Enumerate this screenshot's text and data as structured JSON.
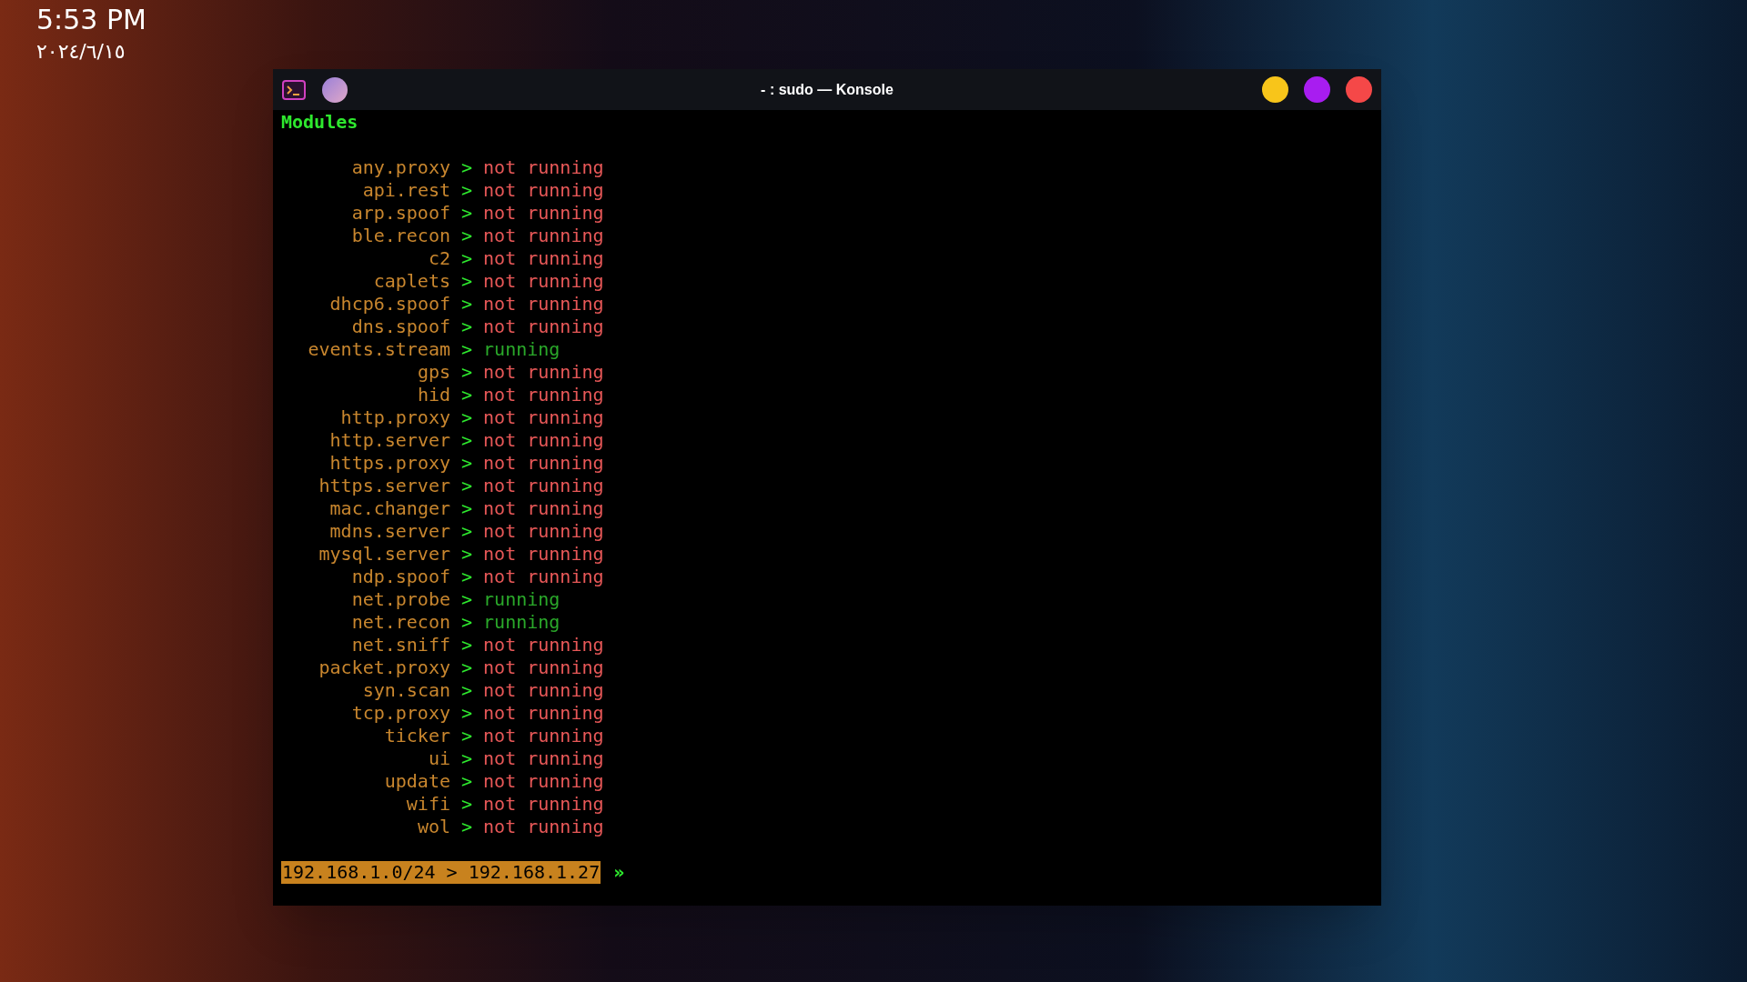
{
  "clock": {
    "time": "5:53 PM",
    "date": "٢٠٢٤/٦/١٥"
  },
  "window": {
    "title": "- : sudo — Konsole"
  },
  "terminal": {
    "heading": "Modules",
    "rows": [
      {
        "name": "any.proxy",
        "sep": ">",
        "status": "not running",
        "running": false
      },
      {
        "name": "api.rest",
        "sep": ">",
        "status": "not running",
        "running": false
      },
      {
        "name": "arp.spoof",
        "sep": ">",
        "status": "not running",
        "running": false
      },
      {
        "name": "ble.recon",
        "sep": ">",
        "status": "not running",
        "running": false
      },
      {
        "name": "c2",
        "sep": ">",
        "status": "not running",
        "running": false
      },
      {
        "name": "caplets",
        "sep": ">",
        "status": "not running",
        "running": false
      },
      {
        "name": "dhcp6.spoof",
        "sep": ">",
        "status": "not running",
        "running": false
      },
      {
        "name": "dns.spoof",
        "sep": ">",
        "status": "not running",
        "running": false
      },
      {
        "name": "events.stream",
        "sep": ">",
        "status": "running",
        "running": true
      },
      {
        "name": "gps",
        "sep": ">",
        "status": "not running",
        "running": false
      },
      {
        "name": "hid",
        "sep": ">",
        "status": "not running",
        "running": false
      },
      {
        "name": "http.proxy",
        "sep": ">",
        "status": "not running",
        "running": false
      },
      {
        "name": "http.server",
        "sep": ">",
        "status": "not running",
        "running": false
      },
      {
        "name": "https.proxy",
        "sep": ">",
        "status": "not running",
        "running": false
      },
      {
        "name": "https.server",
        "sep": ">",
        "status": "not running",
        "running": false
      },
      {
        "name": "mac.changer",
        "sep": ">",
        "status": "not running",
        "running": false
      },
      {
        "name": "mdns.server",
        "sep": ">",
        "status": "not running",
        "running": false
      },
      {
        "name": "mysql.server",
        "sep": ">",
        "status": "not running",
        "running": false
      },
      {
        "name": "ndp.spoof",
        "sep": ">",
        "status": "not running",
        "running": false
      },
      {
        "name": "net.probe",
        "sep": ">",
        "status": "running",
        "running": true
      },
      {
        "name": "net.recon",
        "sep": ">",
        "status": "running",
        "running": true
      },
      {
        "name": "net.sniff",
        "sep": ">",
        "status": "not running",
        "running": false
      },
      {
        "name": "packet.proxy",
        "sep": ">",
        "status": "not running",
        "running": false
      },
      {
        "name": "syn.scan",
        "sep": ">",
        "status": "not running",
        "running": false
      },
      {
        "name": "tcp.proxy",
        "sep": ">",
        "status": "not running",
        "running": false
      },
      {
        "name": "ticker",
        "sep": ">",
        "status": "not running",
        "running": false
      },
      {
        "name": "ui",
        "sep": ">",
        "status": "not running",
        "running": false
      },
      {
        "name": "update",
        "sep": ">",
        "status": "not running",
        "running": false
      },
      {
        "name": "wifi",
        "sep": ">",
        "status": "not running",
        "running": false
      },
      {
        "name": "wol",
        "sep": ">",
        "status": "not running",
        "running": false
      }
    ],
    "prompt": {
      "text": "192.168.1.0/24 > 192.168.1.27",
      "marker": "»"
    }
  }
}
